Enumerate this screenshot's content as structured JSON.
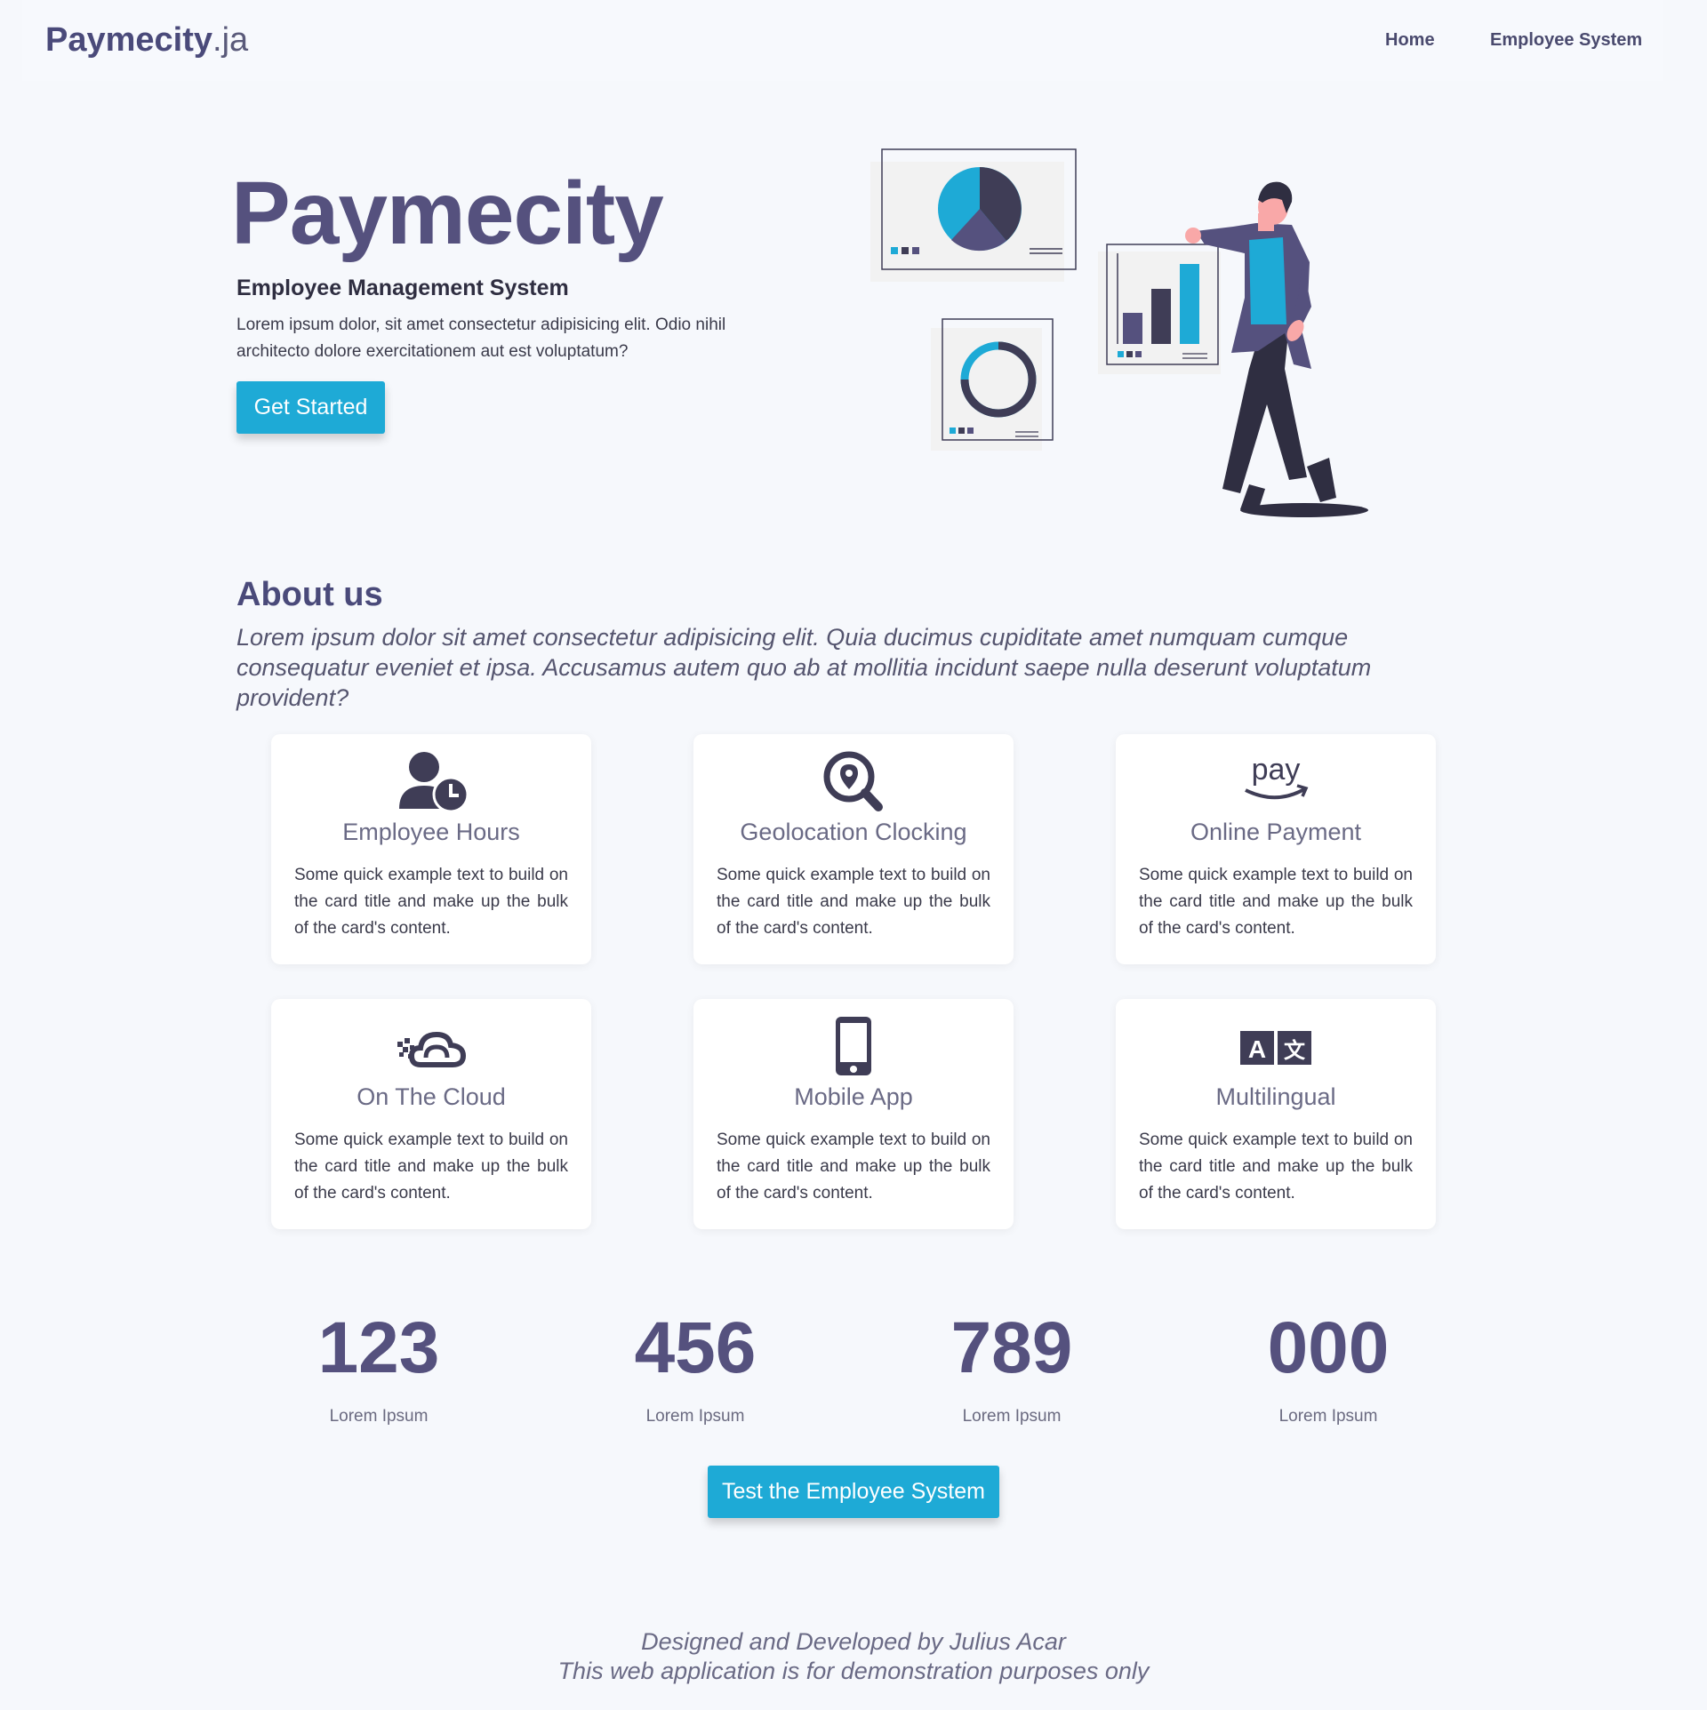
{
  "navbar": {
    "brand_bold": "Paymecity",
    "brand_light": ".ja",
    "links": [
      "Home",
      "Employee System"
    ]
  },
  "hero": {
    "title": "Paymecity",
    "subtitle": "Employee Management System",
    "text": "Lorem ipsum dolor, sit amet consectetur adipisicing elit. Odio nihil architecto dolore exercitationem aut est voluptatum?",
    "button": "Get Started"
  },
  "about": {
    "title": "About us",
    "text": "Lorem ipsum dolor sit amet consectetur adipisicing elit. Quia ducimus cupiditate amet numquam cumque consequatur eveniet et ipsa. Accusamus autem quo ab at mollitia incidunt saepe nulla deserunt voluptatum provident?"
  },
  "cards": [
    {
      "icon": "user-clock-icon",
      "title": "Employee Hours",
      "text": "Some quick example text to build on the card title and make up the bulk of the card's content."
    },
    {
      "icon": "search-location-icon",
      "title": "Geolocation Clocking",
      "text": "Some quick example text to build on the card title and make up the bulk of the card's content."
    },
    {
      "icon": "amazon-pay-icon",
      "title": "Online Payment",
      "text": "Some quick example text to build on the card title and make up the bulk of the card's content."
    },
    {
      "icon": "cloud-icon",
      "title": "On The Cloud",
      "text": "Some quick example text to build on the card title and make up the bulk of the card's content."
    },
    {
      "icon": "mobile-icon",
      "title": "Mobile App",
      "text": "Some quick example text to build on the card title and make up the bulk of the card's content."
    },
    {
      "icon": "language-icon",
      "title": "Multilingual",
      "text": "Some quick example text to build on the card title and make up the bulk of the card's content."
    }
  ],
  "stats": [
    {
      "value": "123",
      "label": "Lorem Ipsum"
    },
    {
      "value": "456",
      "label": "Lorem Ipsum"
    },
    {
      "value": "789",
      "label": "Lorem Ipsum"
    },
    {
      "value": "000",
      "label": "Lorem Ipsum"
    }
  ],
  "cta_button": "Test the Employee System",
  "footer": {
    "line1": "Designed and Developed by Julius Acar",
    "line2": "This web application is for demonstration purposes only"
  },
  "icon_text": {
    "pay": "pay",
    "lang_a": "A",
    "lang_b": "文"
  },
  "colors": {
    "primary": "#55517e",
    "accent": "#1eaad6",
    "dark": "#3f3d56",
    "background": "#f6f8fc"
  }
}
